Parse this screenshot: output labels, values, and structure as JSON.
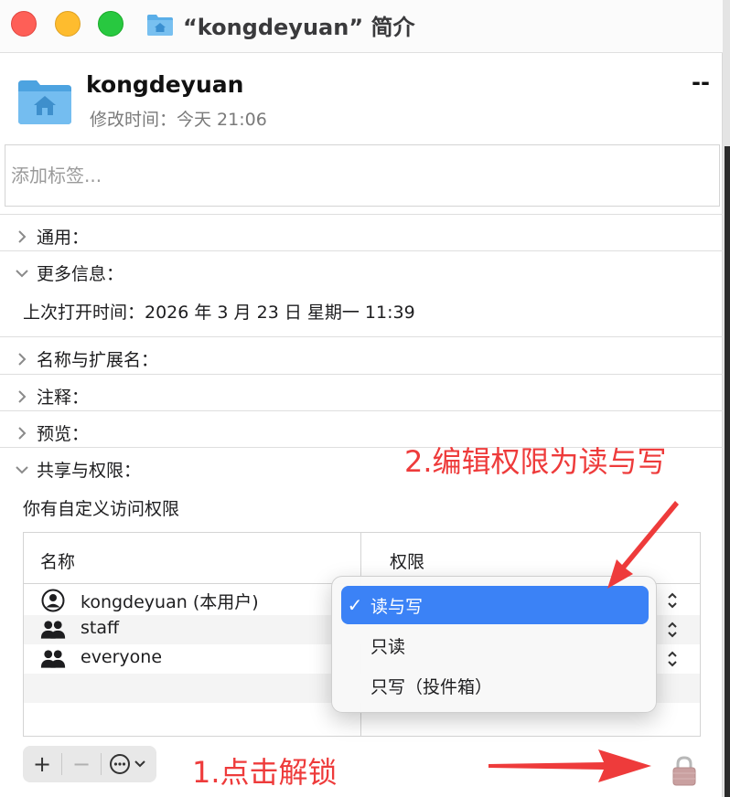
{
  "window": {
    "title": "“kongdeyuan” 简介"
  },
  "header": {
    "file_name": "kongdeyuan",
    "modified": "修改时间：今天 21:06",
    "size": "--"
  },
  "tags": {
    "placeholder": "添加标签..."
  },
  "sections": {
    "general": "通用：",
    "more_info": "更多信息：",
    "last_opened": "上次打开时间：2026 年 3 月 23 日 星期一 11:39",
    "name_ext": "名称与扩展名：",
    "comments": "注释：",
    "preview": "预览：",
    "sharing": "共享与权限：",
    "custom_access": "你有自定义访问权限"
  },
  "permissions": {
    "col_name": "名称",
    "col_privilege": "权限",
    "rows": [
      {
        "name": "kongdeyuan (本用户)",
        "icon": "user-icon"
      },
      {
        "name": "staff",
        "icon": "group-icon"
      },
      {
        "name": "everyone",
        "icon": "group-icon"
      }
    ]
  },
  "popup_menu": {
    "items": [
      {
        "label": "读与写",
        "selected": true
      },
      {
        "label": "只读",
        "selected": false
      },
      {
        "label": "只写（投件箱）",
        "selected": false
      }
    ]
  },
  "toolbar": {
    "add": "+",
    "remove": "−",
    "more_icon": "ellipsis-circle-icon"
  },
  "annotations": {
    "step1": "1.点击解锁",
    "step2": "2.编辑权限为读与写"
  },
  "colors": {
    "accent": "#3b82f6",
    "annotation": "#ee3b3b",
    "folder": "#5aaee8"
  }
}
